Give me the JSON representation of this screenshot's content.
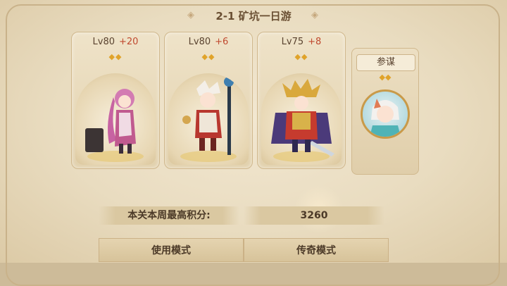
{
  "title": "2-1 矿坑一日游",
  "heroes": [
    {
      "level": "Lv80",
      "bonus": "+20",
      "stars": "◆◆"
    },
    {
      "level": "Lv80",
      "bonus": "+6",
      "stars": "◆◆"
    },
    {
      "level": "Lv75",
      "bonus": "+8",
      "stars": "◆◆"
    }
  ],
  "advisor": {
    "label": "参谋",
    "stars": "◆◆"
  },
  "score": {
    "label": "本关本周最高积分:",
    "value": "3260"
  },
  "buttons": {
    "mode_label": "使用模式",
    "legend_label": "传奇模式"
  },
  "colors": {
    "accent_text": "#6a4f33",
    "bonus": "#c0492f",
    "star": "#e0a32a"
  }
}
